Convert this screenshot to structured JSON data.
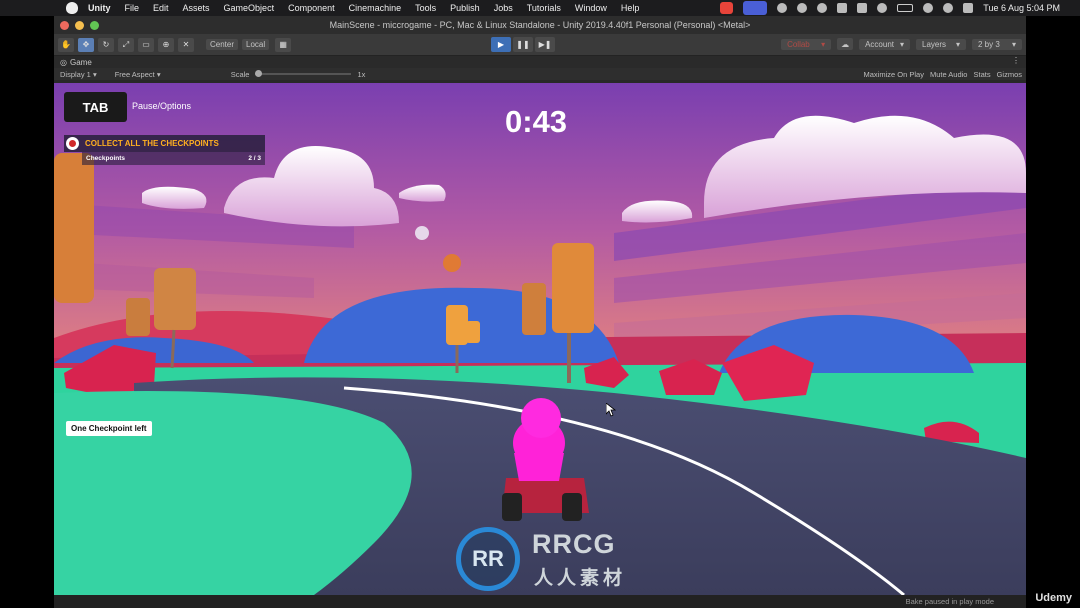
{
  "menubar": {
    "app_name": "Unity",
    "items": [
      "File",
      "Edit",
      "Assets",
      "GameObject",
      "Component",
      "Cinemachine",
      "Tools",
      "Publish",
      "Jobs",
      "Tutorials",
      "Window",
      "Help"
    ],
    "clock": "Tue 6 Aug  5:04 PM"
  },
  "window": {
    "title": "MainScene - miccrogame - PC, Mac & Linux Standalone - Unity 2019.4.40f1 Personal (Personal) <Metal>"
  },
  "toolbar": {
    "tools": [
      "hand-icon",
      "move-icon",
      "rotate-icon",
      "scale-icon",
      "rect-icon",
      "transform-icon",
      "custom-tool-icon"
    ],
    "pivot": "Center",
    "space": "Local",
    "collab": "Collab",
    "account": "Account",
    "layers": "Layers",
    "layout": "2 by 3"
  },
  "game_tab": {
    "label": "Game",
    "display": "Display 1",
    "aspect": "Free Aspect",
    "scale_label": "Scale",
    "scale_value": "1x",
    "maximize": "Maximize On Play",
    "mute": "Mute Audio",
    "stats": "Stats",
    "gizmos": "Gizmos"
  },
  "hud": {
    "tab_key": "TAB",
    "pause_label": "Pause/Options",
    "timer": "0:43",
    "objective_title": "COLLECT ALL THE CHECKPOINTS",
    "objective_sub": "Checkpoints",
    "objective_count": "2 / 3",
    "notification": "One Checkpoint left"
  },
  "watermark": {
    "logo": "RR",
    "main": "RRCG",
    "sub": "人人素材"
  },
  "status": {
    "text": "Bake paused in play mode",
    "brand": "Udemy"
  },
  "colors": {
    "accent": "#3d6fb6",
    "objective": "#ffb020",
    "notif_bg": "#ffffff"
  }
}
